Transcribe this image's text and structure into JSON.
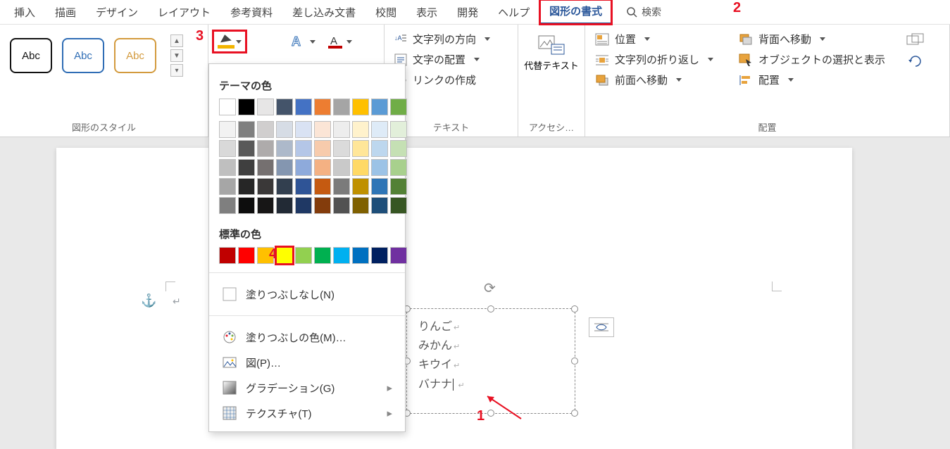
{
  "tabs": {
    "items": [
      "挿入",
      "描画",
      "デザイン",
      "レイアウト",
      "参考資料",
      "差し込み文書",
      "校閲",
      "表示",
      "開発",
      "ヘルプ",
      "図形の書式"
    ],
    "active_index": 10,
    "search_label": "検索"
  },
  "ribbon": {
    "styles": {
      "sample_text": "Abc",
      "group_label": "図形のスタイル"
    },
    "text_group": {
      "direction": "文字列の方向",
      "align": "文字の配置",
      "link": "リンクの作成",
      "group_label": "テキスト"
    },
    "alt_text": {
      "btn": "代替テキスト",
      "group_label": "アクセシ…"
    },
    "arrange": {
      "position": "位置",
      "wrap": "文字列の折り返し",
      "front": "前面へ移動",
      "back": "背面へ移動",
      "select_show": "オブジェクトの選択と表示",
      "align": "配置",
      "group_label": "配置"
    }
  },
  "color_picker": {
    "theme_title": "テーマの色",
    "theme_row1": [
      "#ffffff",
      "#000000",
      "#e7e6e6",
      "#44546a",
      "#4472c4",
      "#ed7d31",
      "#a5a5a5",
      "#ffc000",
      "#5b9bd5",
      "#70ad47"
    ],
    "theme_shades": [
      [
        "#f2f2f2",
        "#7f7f7f",
        "#d0cece",
        "#d6dce5",
        "#d9e2f3",
        "#fbe5d6",
        "#ededed",
        "#fff2cc",
        "#deebf7",
        "#e2efda"
      ],
      [
        "#d9d9d9",
        "#595959",
        "#aeabab",
        "#adb9ca",
        "#b4c6e7",
        "#f7cbac",
        "#dbdbdb",
        "#ffe699",
        "#bdd7ee",
        "#c5e0b4"
      ],
      [
        "#bfbfbf",
        "#3f3f3f",
        "#757070",
        "#8496b0",
        "#8eaadb",
        "#f4b183",
        "#c9c9c9",
        "#ffd966",
        "#9cc3e6",
        "#a8d08d"
      ],
      [
        "#a6a6a6",
        "#262626",
        "#3a3838",
        "#323f4f",
        "#2f5496",
        "#c55a11",
        "#7b7b7b",
        "#bf9000",
        "#2e75b6",
        "#538135"
      ],
      [
        "#7f7f7f",
        "#0d0d0d",
        "#171616",
        "#222a35",
        "#1f3864",
        "#833c0c",
        "#525252",
        "#7f6000",
        "#1e4e79",
        "#375623"
      ]
    ],
    "standard_title": "標準の色",
    "standard": [
      "#c00000",
      "#ff0000",
      "#ffc000",
      "#ffff00",
      "#92d050",
      "#00b050",
      "#00b0f0",
      "#0070c0",
      "#002060",
      "#7030a0"
    ],
    "standard_selected_index": 3,
    "no_fill": "塗りつぶしなし(N)",
    "more_colors": "塗りつぶしの色(M)…",
    "picture": "図(P)…",
    "gradient": "グラデーション(G)",
    "texture": "テクスチャ(T)"
  },
  "document": {
    "shape_lines": [
      "りんご",
      "みかん",
      "キウイ",
      "バナナ"
    ]
  },
  "annotations": {
    "n1": "1",
    "n2": "2",
    "n3": "3",
    "n4": "4"
  }
}
